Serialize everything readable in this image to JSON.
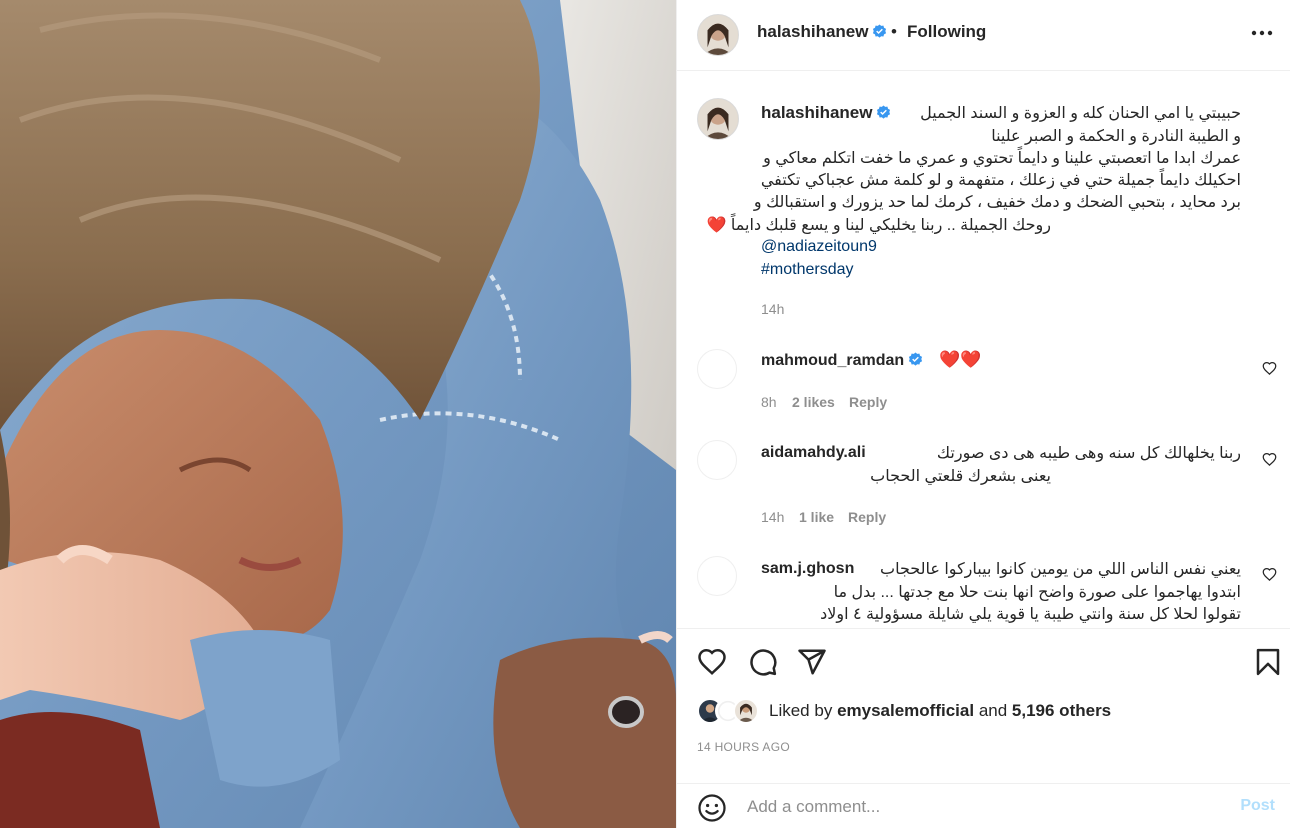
{
  "header": {
    "username": "halashihanew",
    "separator": "•",
    "follow_status": "Following"
  },
  "caption": {
    "username": "halashihanew",
    "lines": [
      "حبيبتي يا امي الحنان كله و العزوة و السند الجميل",
      "و الطيبة النادرة و الحكمة و الصبر علينا",
      "عمرك ابدا ما اتعصبتي علينا و دايماً تحتوي و عمري ما خفت اتكلم معاكي و",
      "احكيلك دايماً جميلة حتي في زعلك ، متفهمة و لو كلمة مش عجباكي تكتفي",
      "برد محايد ، بتحبي الضحك و دمك خفيف ، كرمك لما حد يزورك و استقبالك و",
      "روحك الجميلة .. ربنا يخليكي لينا و يسع قلبك دايماً ❤️"
    ],
    "mention": "@nadiazeitoun9",
    "hashtag": "#mothersday",
    "time": "14h"
  },
  "comments": [
    {
      "username": "mahmoud_ramdan",
      "verified": true,
      "text": "❤️❤️",
      "lines": [],
      "time": "8h",
      "likes": "2 likes",
      "reply": "Reply"
    },
    {
      "username": "aidamahdy.ali",
      "verified": false,
      "text": "",
      "lines": [
        "ربنا يخلهالك كل سنه وهى طيبه هى دى صورتك",
        "يعنى بشعرك قلعتي الحجاب"
      ],
      "time": "14h",
      "likes": "1 like",
      "reply": "Reply"
    },
    {
      "username": "sam.j.ghosn",
      "verified": false,
      "text": "",
      "lines": [
        "يعني نفس الناس اللي من يومين كانوا بيباركوا عالحجاب",
        "ابتدوا يهاجموا على صورة واضح انها بنت حلا مع جدتها ... بدل ما",
        "تقولوا لحلا كل سنة وانتي طيبة يا قوية يلي شايلة مسؤولية ٤ اولاد"
      ]
    }
  ],
  "actions": {
    "liked_by_prefix": "Liked by",
    "liked_by_user": "emysalemofficial",
    "liked_by_and": "and",
    "liked_by_others": "5,196 others",
    "time_ago": "14 HOURS AGO"
  },
  "composer": {
    "placeholder": "Add a comment...",
    "post_label": "Post"
  },
  "colors": {
    "verified_blue": "#3897f0",
    "link_blue": "#00376b",
    "muted_gray": "#8e8e8e",
    "post_disabled": "#b2dffc",
    "heart_red": "#e0245e"
  },
  "icons": [
    "more-options-icon",
    "verified-badge-icon",
    "heart-icon",
    "comment-icon",
    "share-icon",
    "bookmark-icon",
    "emoji-icon"
  ]
}
